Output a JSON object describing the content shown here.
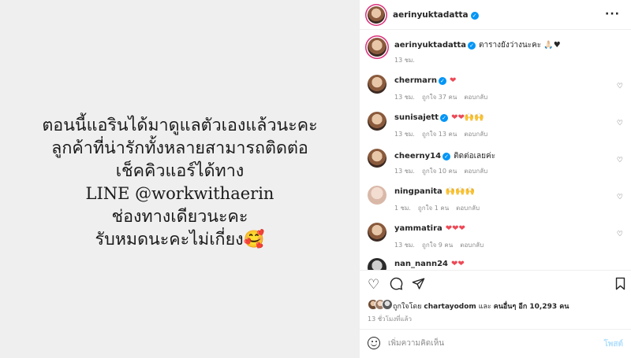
{
  "post_image": {
    "lines": [
      "ตอนนี้แอรินได้มาดูแลตัวเองแล้วนะคะ",
      "ลูกค้าที่น่ารักทั้งหลายสามารถติดต่อ",
      "เช็คคิวแอร์ได้ทาง",
      "LINE @workwithaerin",
      "ช่องทางเดียวนะคะ",
      "รับหมดนะคะไม่เกี่ยง🥰"
    ]
  },
  "header": {
    "username": "aerinyuktadatta"
  },
  "caption": {
    "username": "aerinyuktadatta",
    "text": "ตารางยังว่างนะคะ 🙏🏻♥",
    "time": "13 ชม."
  },
  "comments": [
    {
      "username": "chermarn",
      "text": "❤",
      "time": "13 ชม.",
      "likes": "ถูกใจ 37 คน",
      "reply": "ตอบกลับ"
    },
    {
      "username": "sunisajett",
      "text": "❤❤🙌🙌",
      "time": "13 ชม.",
      "likes": "ถูกใจ 13 คน",
      "reply": "ตอบกลับ"
    },
    {
      "username": "cheerny14",
      "text": "ติดต่อเลยค่ะ",
      "time": "13 ชม.",
      "likes": "ถูกใจ 10 คน",
      "reply": "ตอบกลับ"
    },
    {
      "username": "ningpanita",
      "text": "🙌🙌🙌",
      "time": "1 ชม.",
      "likes": "ถูกใจ 1 คน",
      "reply": "ตอบกลับ"
    },
    {
      "username": "yammatira",
      "text": "❤❤❤",
      "time": "13 ชม.",
      "likes": "ถูกใจ 9 คน",
      "reply": "ตอบกลับ"
    },
    {
      "username": "nan_nann24",
      "text": "❤❤",
      "time": "",
      "likes": "",
      "reply": ""
    }
  ],
  "likes": {
    "prefix": "ถูกใจโดย",
    "user": "chartayodom",
    "mid": "และ",
    "others": "คนอื่นๆ อีก 10,293 คน"
  },
  "time_ago": "13 ชั่วโมงที่แล้ว",
  "comment_box": {
    "placeholder": "เพิ่มความคิดเห็น",
    "post_label": "โพสต์"
  }
}
